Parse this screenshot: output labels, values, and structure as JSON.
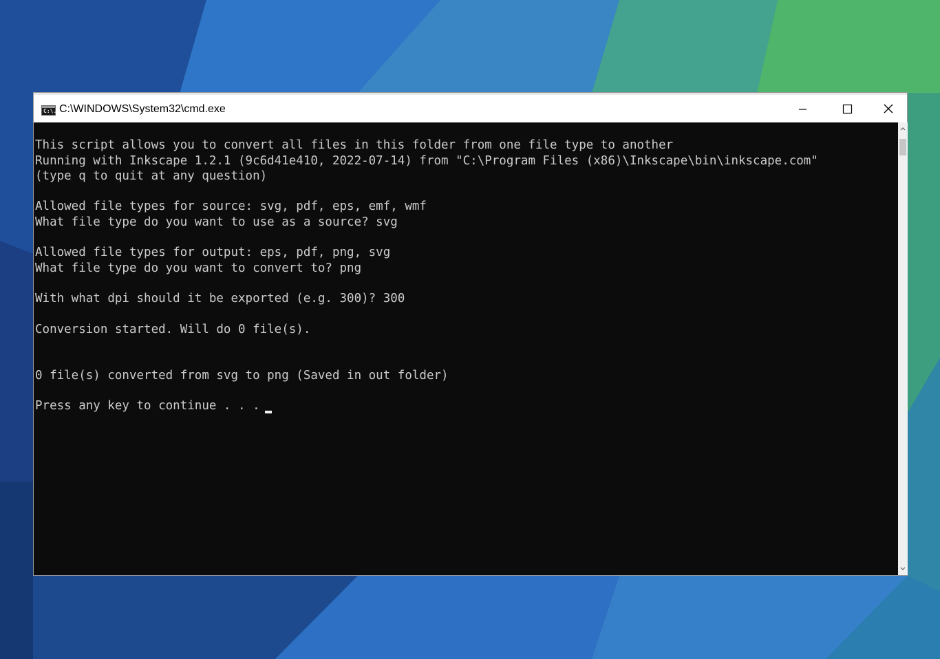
{
  "window": {
    "title": "C:\\WINDOWS\\System32\\cmd.exe",
    "icon": "cmd-app-icon",
    "icon_glyph": "C:\\.",
    "controls": {
      "minimize_icon": "minimize-icon",
      "maximize_icon": "maximize-icon",
      "close_icon": "close-icon"
    }
  },
  "console": {
    "lines": [
      "This script allows you to convert all files in this folder from one file type to another",
      "Running with Inkscape 1.2.1 (9c6d41e410, 2022-07-14) from \"C:\\Program Files (x86)\\Inkscape\\bin\\inkscape.com\"",
      "(type q to quit at any question)",
      "",
      "Allowed file types for source: svg, pdf, eps, emf, wmf",
      "What file type do you want to use as a source? svg",
      "",
      "Allowed file types for output: eps, pdf, png, svg",
      "What file type do you want to convert to? png",
      "",
      "With what dpi should it be exported (e.g. 300)? 300",
      "",
      "Conversion started. Will do 0 file(s).",
      "",
      "",
      "0 file(s) converted from svg to png (Saved in out folder)",
      "",
      "Press any key to continue . . . "
    ],
    "text_color": "#cccccc",
    "background_color": "#0c0c0c"
  },
  "colors": {
    "titlebar": "#ffffff",
    "console_bg": "#0c0c0c",
    "console_text": "#cccccc",
    "scrollbar_track": "#f0f0f0",
    "scrollbar_thumb": "#c6c6c6"
  }
}
